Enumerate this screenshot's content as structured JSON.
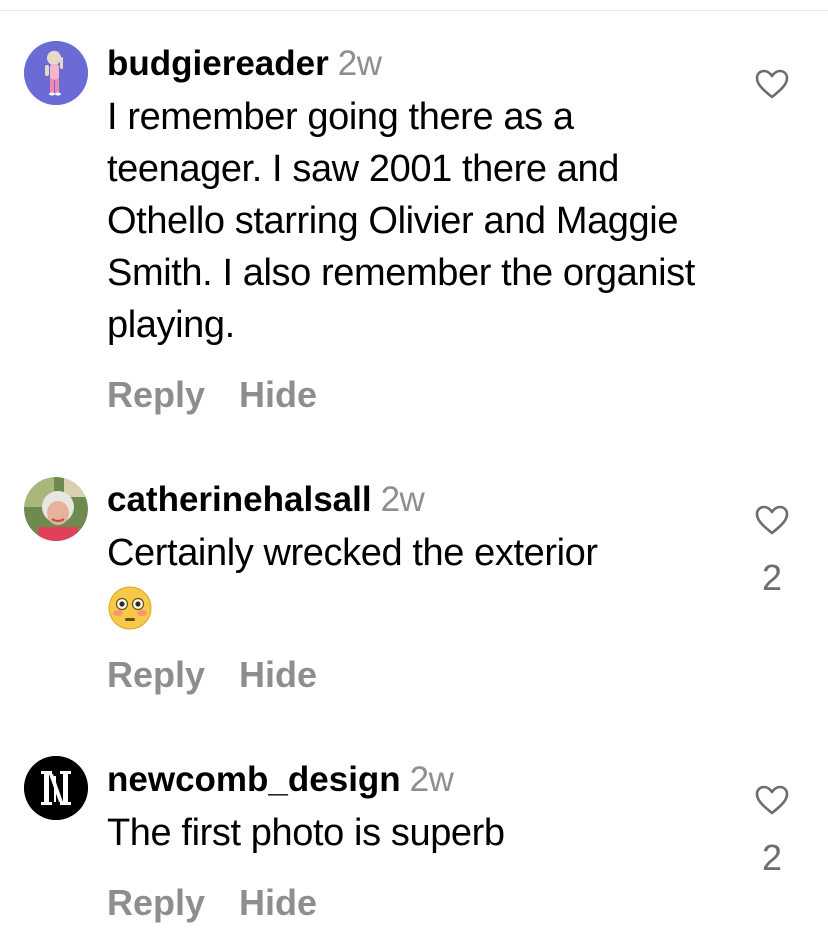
{
  "comments": [
    {
      "username": "budgiereader",
      "time": "2w",
      "text": "I remember going there as a teenager. I saw 2001 there and Othello starring Olivier and Maggie Smith. I also remember the organist playing.",
      "reply_label": "Reply",
      "hide_label": "Hide",
      "like_count": ""
    },
    {
      "username": "catherinehalsall",
      "time": "2w",
      "text": "Certainly wrecked the exterior",
      "emoji": "flushed-face",
      "reply_label": "Reply",
      "hide_label": "Hide",
      "like_count": "2"
    },
    {
      "username": "newcomb_design",
      "time": "2w",
      "text": "The first photo is superb",
      "reply_label": "Reply",
      "hide_label": "Hide",
      "like_count": "2"
    }
  ],
  "colors": {
    "secondary_text": "#8e8e8e",
    "primary_text": "#000000",
    "avatar_1_bg": "#6b6bd6"
  },
  "icons": [
    "heart-icon",
    "flushed-face-emoji"
  ]
}
